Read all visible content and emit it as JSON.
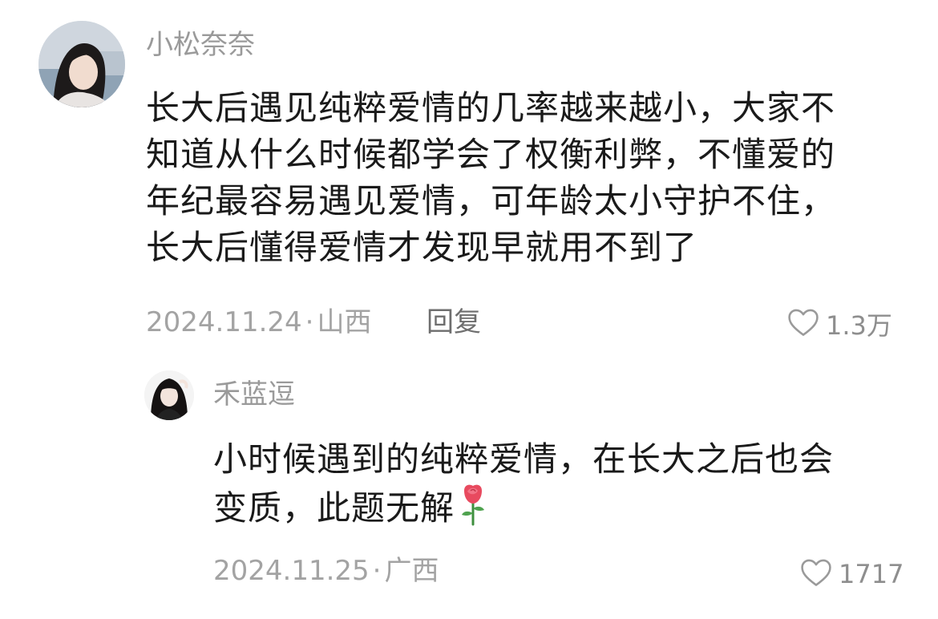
{
  "comments": [
    {
      "username": "小松奈奈",
      "lines": [
        "长大后遇见纯粹爱情的几率越来越小，大家不",
        "知道从什么时候都学会了权衡利弊，不懂爱的",
        "年纪最容易遇见爱情，可年龄太小守护不住，",
        "长大后懂得爱情才发现早就用不到了"
      ],
      "date": "2024.11.24",
      "separator": "·",
      "location": "山西",
      "reply_label": "回复",
      "likes": "1.3万",
      "icons": {
        "like": "heart-outline-icon"
      }
    },
    {
      "username": "禾蓝逗",
      "lines": [
        "小时候遇到的纯粹爱情，在长大之后也会",
        "变质，此题无解"
      ],
      "emoji": "rose-emoji-icon",
      "date": "2024.11.25",
      "separator": "·",
      "location": "广西",
      "likes": "1717",
      "icons": {
        "like": "heart-outline-icon"
      }
    }
  ],
  "colors": {
    "text_primary": "#1a1a1a",
    "text_secondary": "#9a9a9a",
    "rose_red": "#e84a5f",
    "stem_green": "#3f8f3f"
  }
}
